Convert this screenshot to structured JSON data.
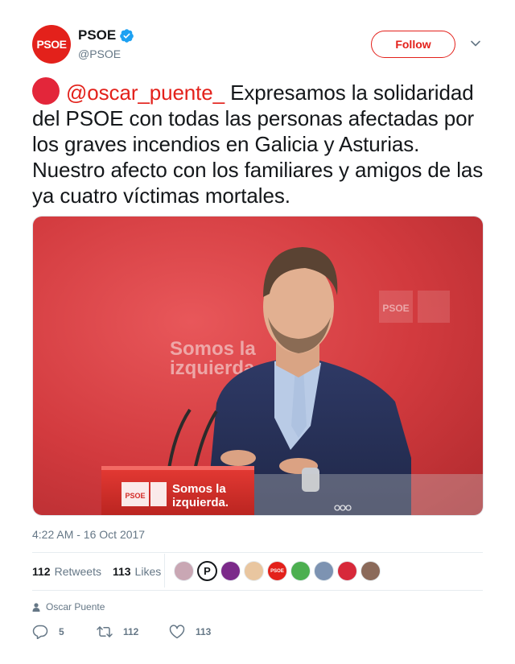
{
  "account": {
    "avatar_text": "PSOE",
    "name": "PSOE",
    "handle": "@PSOE",
    "verified": true,
    "follow_label": "Follow"
  },
  "tweet": {
    "mention": "@oscar_puente_",
    "text": " Expresamos la solidaridad del PSOE con todas las personas afectadas por los graves incendios en Galicia y Asturias. Nuestro afecto con los familiares y amigos de las ya cuatro víctimas mortales.",
    "timestamp": "4:22 AM - 16 Oct 2017",
    "photo_texts": {
      "podium_logo": "PSOE",
      "podium_slogan_line1": "Somos la",
      "podium_slogan_line2": "izquierda.",
      "backdrop_logo": "PSOE",
      "backdrop_slogan_line1": "Somos la",
      "backdrop_slogan_line2": "izquierda"
    }
  },
  "stats": {
    "retweets_count": "112",
    "retweets_label": "Retweets",
    "likes_count": "113",
    "likes_label": "Likes"
  },
  "liker_avatars": [
    {
      "name": "liker-avatar-1",
      "color": "#c9a7b4"
    },
    {
      "name": "liker-avatar-2",
      "color": "#ffffff",
      "letter": "P"
    },
    {
      "name": "liker-avatar-3",
      "color": "#7b2a8a"
    },
    {
      "name": "liker-avatar-4",
      "color": "#e9c6a0"
    },
    {
      "name": "liker-avatar-5",
      "color": "#e3211b",
      "text": "PSOE"
    },
    {
      "name": "liker-avatar-6",
      "color": "#4caf50"
    },
    {
      "name": "liker-avatar-7",
      "color": "#7d93b2"
    },
    {
      "name": "liker-avatar-8",
      "color": "#d7293a"
    },
    {
      "name": "liker-avatar-9",
      "color": "#8b6a5a"
    }
  ],
  "reply_context": {
    "icon": "person-icon",
    "name": "Oscar Puente"
  },
  "actions": {
    "replies": "5",
    "retweets": "112",
    "likes": "113"
  },
  "colors": {
    "brand_red": "#e3211b",
    "secondary_text": "#657786",
    "divider": "#e6ecf0"
  }
}
